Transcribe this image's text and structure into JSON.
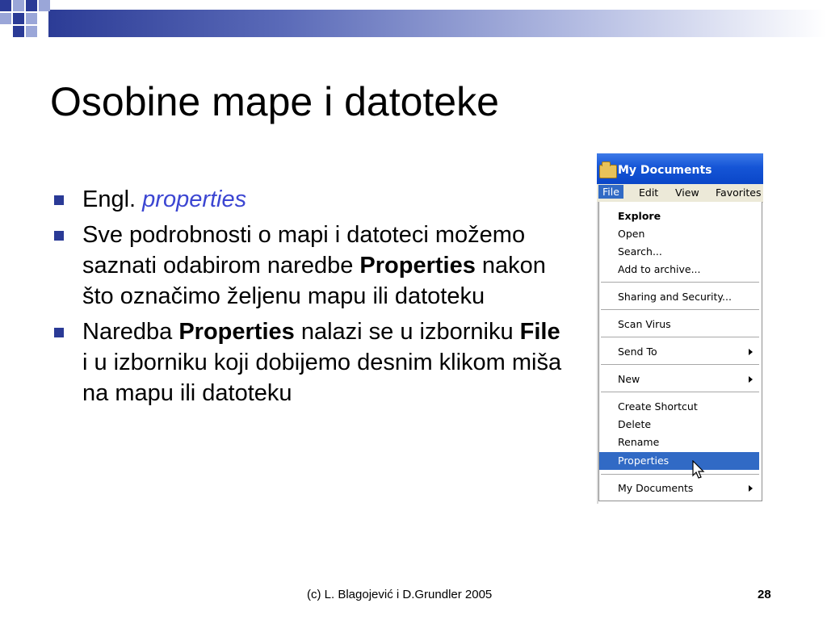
{
  "slide": {
    "title": "Osobine mape i datoteke",
    "bullets": [
      {
        "plain": "Engl. ",
        "italic": "properties"
      },
      {
        "text": "Sve podrobnosti o mapi i datoteci možemo saznati odabirom naredbe ",
        "bold": "Properties",
        "after": " nakon što označimo željenu mapu ili datoteku"
      },
      {
        "text1": "Naredba ",
        "bold1": "Properties",
        "text2": " nalazi se u izborniku ",
        "bold2": "File",
        "text3": " i u izborniku koji dobijemo desnim klikom miša na mapu ili datoteku"
      }
    ],
    "footer": "(c) L. Blagojević i D.Grundler 2005",
    "page_number": "28"
  },
  "window": {
    "title": "My Documents",
    "menubar": [
      "File",
      "Edit",
      "View",
      "Favorites"
    ],
    "menu_items": [
      "Explore",
      "Open",
      "Search...",
      "Add to archive...",
      "Sharing and Security...",
      "Scan Virus",
      "Send To",
      "New",
      "Create Shortcut",
      "Delete",
      "Rename",
      "Properties",
      "My Documents"
    ]
  },
  "colors": {
    "accent": "#2a3a96",
    "italic_text": "#3c46d2",
    "selection": "#316ac5",
    "titlebar": "#1555d6"
  }
}
